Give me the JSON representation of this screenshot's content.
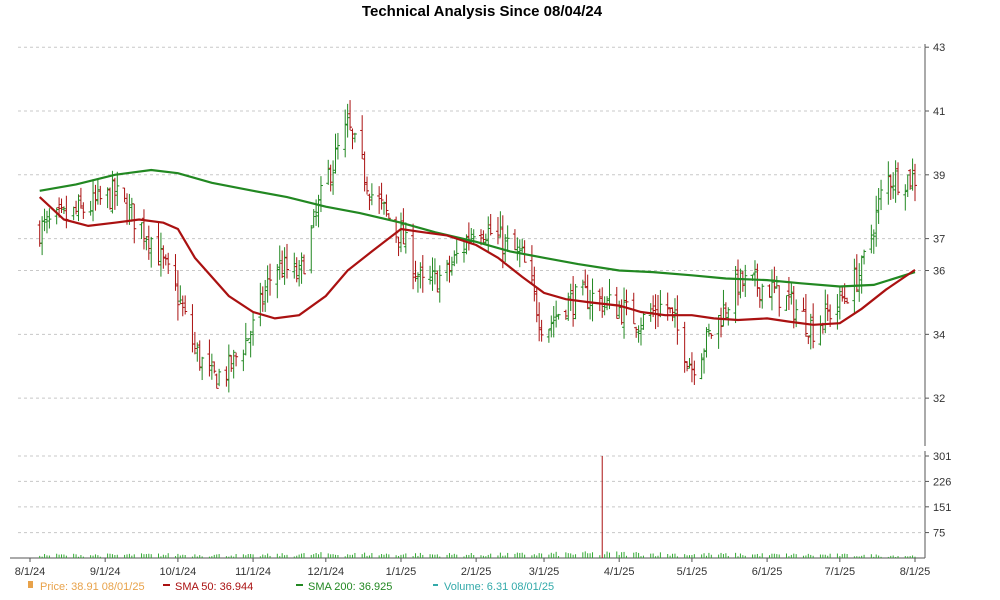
{
  "chart_data": {
    "type": "line",
    "title": "Technical Analysis Since 08/04/24",
    "x_labels": [
      "8/1/24",
      "9/1/24",
      "10/1/24",
      "11/1/24",
      "12/1/24",
      "1/1/25",
      "2/1/25",
      "3/1/25",
      "4/1/25",
      "5/1/25",
      "6/1/25",
      "7/1/25",
      "8/1/25"
    ],
    "price_axis": {
      "ylim": [
        30.5,
        43.1
      ],
      "ticks": [
        "32",
        "34",
        "36",
        "37",
        "39",
        "41",
        "43"
      ],
      "tick_values": [
        32,
        34,
        36,
        37,
        39,
        41,
        43
      ]
    },
    "volume_axis": {
      "ylim": [
        0,
        301
      ],
      "ticks": [
        "75",
        "151",
        "226",
        "301"
      ],
      "tick_values": [
        75,
        151,
        226,
        301
      ]
    },
    "grid": true,
    "series": [
      {
        "name": "SMA 50",
        "color": "#aa1111",
        "dates": [
          "2024-08-05",
          "2024-08-15",
          "2024-08-25",
          "2024-09-05",
          "2024-09-15",
          "2024-09-25",
          "2024-10-01",
          "2024-10-08",
          "2024-10-15",
          "2024-10-22",
          "2024-11-01",
          "2024-11-10",
          "2024-11-20",
          "2024-12-01",
          "2024-12-10",
          "2024-12-20",
          "2025-01-01",
          "2025-01-10",
          "2025-01-20",
          "2025-02-01",
          "2025-02-10",
          "2025-02-20",
          "2025-03-01",
          "2025-03-10",
          "2025-03-20",
          "2025-04-01",
          "2025-04-10",
          "2025-04-20",
          "2025-05-01",
          "2025-05-10",
          "2025-05-20",
          "2025-06-01",
          "2025-06-10",
          "2025-06-20",
          "2025-07-01",
          "2025-07-10",
          "2025-07-20",
          "2025-08-01"
        ],
        "values": [
          38.3,
          37.6,
          37.4,
          37.5,
          37.6,
          37.5,
          37.3,
          36.4,
          35.8,
          35.2,
          34.7,
          34.5,
          34.6,
          35.2,
          36.0,
          36.6,
          37.3,
          37.2,
          37.1,
          36.8,
          36.4,
          35.8,
          35.3,
          35.1,
          35.0,
          34.9,
          34.7,
          34.6,
          34.6,
          34.5,
          34.45,
          34.5,
          34.4,
          34.3,
          34.35,
          34.8,
          35.4,
          36.02
        ]
      },
      {
        "name": "SMA 200",
        "color": "#228822",
        "dates": [
          "2024-08-05",
          "2024-08-20",
          "2024-09-05",
          "2024-09-20",
          "2024-10-01",
          "2024-10-15",
          "2024-11-01",
          "2024-11-15",
          "2024-12-01",
          "2024-12-15",
          "2025-01-01",
          "2025-01-15",
          "2025-02-01",
          "2025-02-15",
          "2025-03-01",
          "2025-03-15",
          "2025-04-01",
          "2025-04-15",
          "2025-05-01",
          "2025-05-15",
          "2025-06-01",
          "2025-06-15",
          "2025-07-01",
          "2025-07-15",
          "2025-08-01"
        ],
        "values": [
          38.5,
          38.7,
          39.0,
          39.15,
          39.05,
          38.75,
          38.5,
          38.3,
          38.0,
          37.8,
          37.5,
          37.2,
          36.9,
          36.6,
          36.4,
          36.2,
          36.0,
          35.95,
          35.85,
          35.75,
          35.7,
          35.6,
          35.5,
          35.55,
          35.95
        ]
      }
    ],
    "price_bar_summary": {
      "dates": [
        "2024-08-05",
        "2024-08-20",
        "2024-09-05",
        "2024-09-20",
        "2024-10-01",
        "2024-10-08",
        "2024-10-15",
        "2024-10-22",
        "2024-11-01",
        "2024-11-10",
        "2024-11-20",
        "2024-12-01",
        "2024-12-10",
        "2024-12-20",
        "2025-01-01",
        "2025-01-10",
        "2025-01-20",
        "2025-02-01",
        "2025-02-10",
        "2025-02-20",
        "2025-03-01",
        "2025-03-10",
        "2025-03-20",
        "2025-04-01",
        "2025-04-10",
        "2025-04-20",
        "2025-05-01",
        "2025-05-10",
        "2025-05-20",
        "2025-06-01",
        "2025-06-10",
        "2025-06-20",
        "2025-07-01",
        "2025-07-10",
        "2025-07-20",
        "2025-08-01"
      ],
      "close": [
        37.3,
        37.8,
        38.4,
        37.0,
        35.2,
        33.5,
        32.6,
        32.9,
        34.2,
        36.2,
        35.8,
        38.8,
        40.5,
        38.4,
        37.1,
        35.5,
        35.9,
        37.5,
        37.0,
        36.4,
        34.1,
        35.0,
        35.2,
        34.8,
        34.4,
        35.0,
        33.0,
        34.2,
        35.6,
        35.5,
        35.0,
        34.2,
        35.0,
        36.0,
        38.9,
        38.91
      ]
    },
    "volume": {
      "dates": [
        "2024-09-01",
        "2024-10-01",
        "2024-11-01",
        "2024-12-01",
        "2025-01-01",
        "2025-02-01",
        "2025-03-01",
        "2025-03-25",
        "2025-04-01",
        "2025-05-01",
        "2025-06-01",
        "2025-07-01",
        "2025-08-01"
      ],
      "values": [
        9,
        10,
        8,
        12,
        11,
        10,
        12,
        301,
        14,
        11,
        10,
        9,
        6.31
      ]
    }
  },
  "legend": {
    "price": {
      "label": "Price: 38.91  08/01/25",
      "color": "#e8a24a"
    },
    "sma50": {
      "label": "SMA 50: 36.944",
      "color": "#aa1111"
    },
    "sma200": {
      "label": "SMA 200: 36.925",
      "color": "#228822"
    },
    "volume": {
      "label": "Volume: 6.31  08/01/25",
      "color": "#33aaaa"
    }
  },
  "colors": {
    "price_bar": "#228822",
    "price_bar_down": "#aa1111",
    "volume_bar": "#33aa33",
    "volume_spike": "#aa1111"
  }
}
